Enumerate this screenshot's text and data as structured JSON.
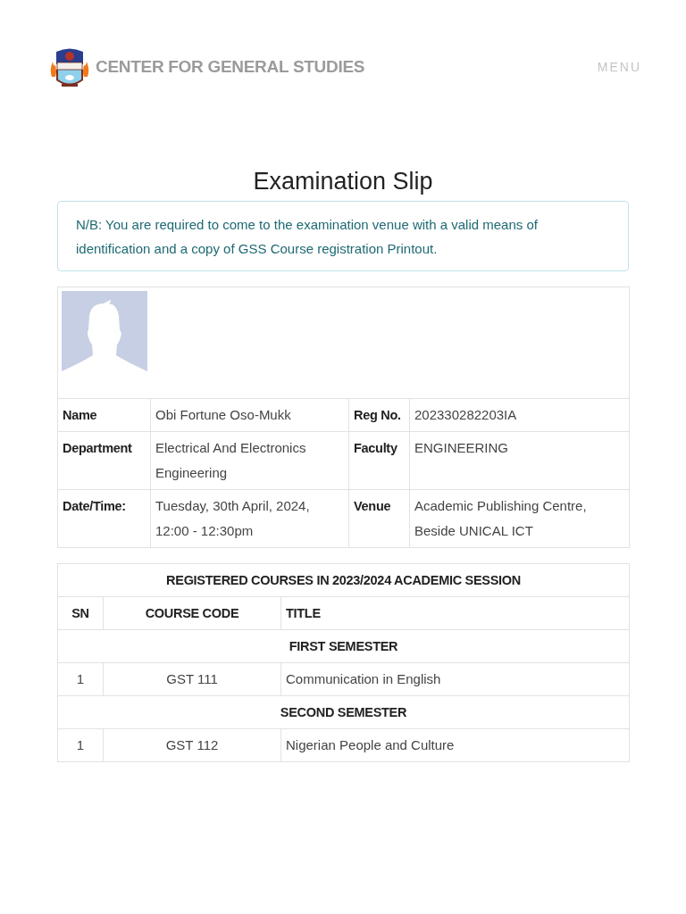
{
  "header": {
    "brand": "CENTER FOR GENERAL STUDIES",
    "menu": "MENU"
  },
  "title": "Examination Slip",
  "notice": "N/B: You are required to come to the examination venue with a valid means of identification and a copy of GSS Course registration Printout.",
  "student": {
    "rows": [
      [
        {
          "label": "Name",
          "value": "Obi Fortune Oso-Mukk"
        },
        {
          "label": "Reg No.",
          "value": "202330282203IA"
        }
      ],
      [
        {
          "label": "Department",
          "value": "Electrical And Electronics Engineering"
        },
        {
          "label": "Faculty",
          "value": "ENGINEERING"
        }
      ],
      [
        {
          "label": "Date/Time:",
          "value": "Tuesday, 30th April, 2024, 12:00 - 12:30pm"
        },
        {
          "label": "Venue",
          "value": "Academic Publishing Centre, Beside UNICAL ICT"
        }
      ]
    ]
  },
  "courses": {
    "caption": "REGISTERED COURSES IN 2023/2024 ACADEMIC SESSION",
    "columns": [
      "SN",
      "COURSE CODE",
      "TITLE"
    ],
    "sections": [
      {
        "heading": "FIRST SEMESTER",
        "rows": [
          {
            "sn": "1",
            "code": "GST 111",
            "title": "Communication in English"
          }
        ]
      },
      {
        "heading": "SECOND SEMESTER",
        "rows": [
          {
            "sn": "1",
            "code": "GST 112",
            "title": "Nigerian People and Culture"
          }
        ]
      }
    ]
  }
}
